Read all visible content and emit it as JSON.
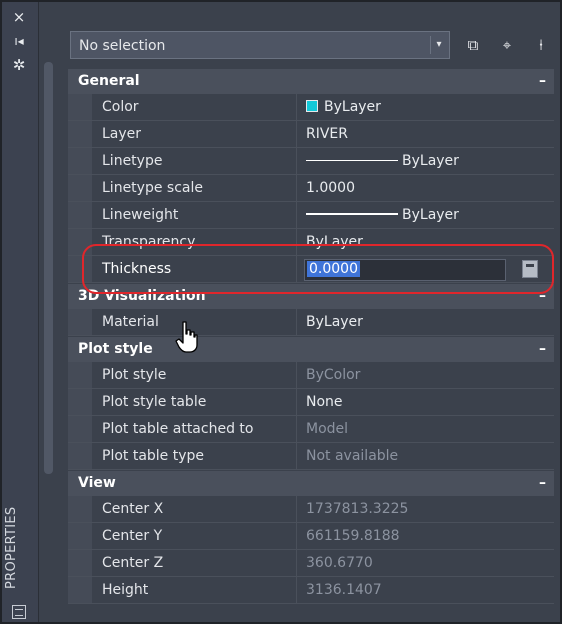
{
  "window": {
    "title": "PROPERTIES",
    "close_glyph": "×",
    "pin_glyph": "ı◂",
    "settings_glyph": "✲"
  },
  "selection": {
    "value": "No selection",
    "dropdown_glyph": "▾"
  },
  "toolbar": {
    "toggle_pickadd_glyph": "⧉",
    "select_objects_glyph": "⌖",
    "quick_select_glyph": "⍿"
  },
  "categories": {
    "general": {
      "label": "General",
      "collapse": "–"
    },
    "visualization": {
      "label": "3D Visualization",
      "collapse": "–"
    },
    "plot": {
      "label": "Plot style",
      "collapse": "–"
    },
    "view": {
      "label": "View",
      "collapse": "–"
    }
  },
  "general": {
    "color": {
      "name": "Color",
      "value": "ByLayer"
    },
    "layer": {
      "name": "Layer",
      "value": "RIVER"
    },
    "linetype": {
      "name": "Linetype",
      "value": "ByLayer"
    },
    "linetype_scale": {
      "name": "Linetype scale",
      "value": "1.0000"
    },
    "lineweight": {
      "name": "Lineweight",
      "value": "ByLayer"
    },
    "transparency": {
      "name": "Transparency",
      "value": "ByLayer"
    },
    "thickness": {
      "name": "Thickness",
      "value": "0.0000"
    }
  },
  "visualization": {
    "material": {
      "name": "Material",
      "value": "ByLayer"
    }
  },
  "plot": {
    "plot_style": {
      "name": "Plot style",
      "value": "ByColor"
    },
    "plot_style_table": {
      "name": "Plot style table",
      "value": "None"
    },
    "plot_table_attached": {
      "name": "Plot table attached to",
      "value": "Model"
    },
    "plot_table_type": {
      "name": "Plot table type",
      "value": "Not available"
    }
  },
  "view": {
    "center_x": {
      "name": "Center X",
      "value": "1737813.3225"
    },
    "center_y": {
      "name": "Center Y",
      "value": "661159.8188"
    },
    "center_z": {
      "name": "Center Z",
      "value": "360.6770"
    },
    "height": {
      "name": "Height",
      "value": "3136.1407"
    }
  },
  "colors": {
    "color_swatch": "#12c8d8",
    "selection_highlight": "#3f74d9",
    "annotation_outline": "#e0262b"
  }
}
